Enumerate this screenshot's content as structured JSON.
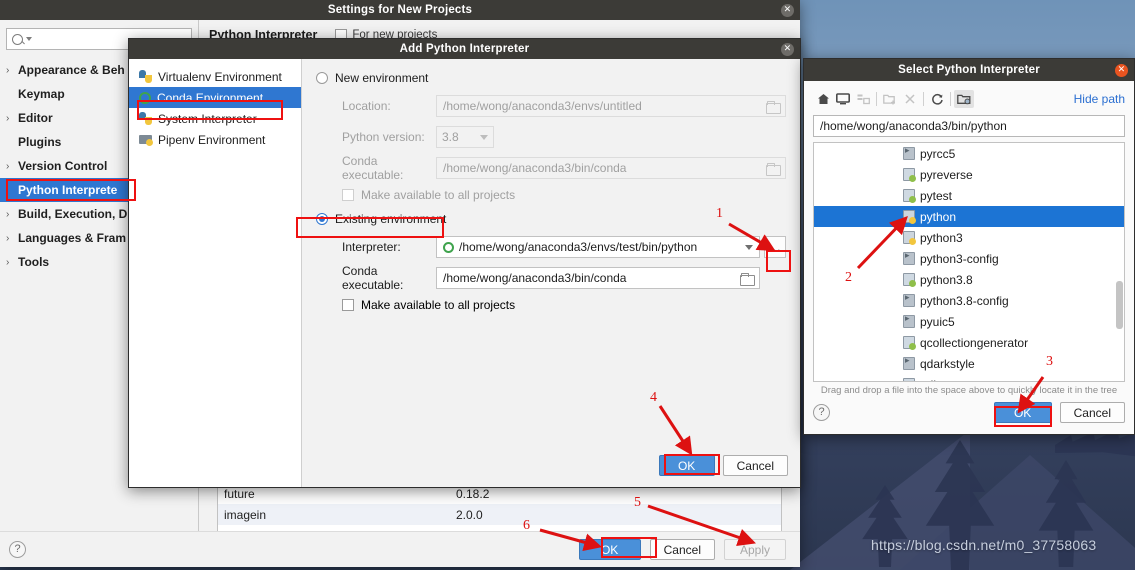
{
  "desktop": {
    "watermark": "https://blog.csdn.net/m0_37758063"
  },
  "settings_window": {
    "title": "Settings for New Projects",
    "close_label": "✕",
    "search_placeholder": "Q-",
    "nav_items": [
      {
        "label": "Appearance & Beh",
        "expandable": true,
        "selected": false
      },
      {
        "label": "Keymap",
        "expandable": false,
        "selected": false
      },
      {
        "label": "Editor",
        "expandable": true,
        "selected": false
      },
      {
        "label": "Plugins",
        "expandable": false,
        "selected": false
      },
      {
        "label": "Version Control",
        "expandable": true,
        "selected": false
      },
      {
        "label": "Python Interprete",
        "expandable": false,
        "selected": true
      },
      {
        "label": "Build, Execution, D",
        "expandable": true,
        "selected": false
      },
      {
        "label": "Languages & Fram",
        "expandable": true,
        "selected": false
      },
      {
        "label": "Tools",
        "expandable": true,
        "selected": false
      }
    ],
    "main_title": "Python Interpreter",
    "main_checkbox_label": "For new projects",
    "packages": {
      "rows": [
        {
          "name": "future",
          "version": "0.18.2"
        },
        {
          "name": "imagein",
          "version": "2.0.0"
        }
      ]
    },
    "footer": {
      "help_label": "?",
      "ok_label": "OK",
      "cancel_label": "Cancel",
      "apply_label": "Apply"
    }
  },
  "add_interpreter_dialog": {
    "title": "Add Python Interpreter",
    "close_label": "✕",
    "env_list": [
      {
        "label": "Virtualenv Environment",
        "icon": "virtualenv-icon",
        "selected": false
      },
      {
        "label": "Conda Environment",
        "icon": "conda-ring-icon",
        "selected": true
      },
      {
        "label": "System Interpreter",
        "icon": "python-icon",
        "selected": false
      },
      {
        "label": "Pipenv Environment",
        "icon": "pipenv-icon",
        "selected": false
      }
    ],
    "new_env": {
      "radio_label": "New environment",
      "selected": false,
      "location_label": "Location:",
      "location_value": "/home/wong/anaconda3/envs/untitled",
      "python_version_label": "Python version:",
      "python_version_value": "3.8",
      "conda_exec_label": "Conda executable:",
      "conda_exec_value": "/home/wong/anaconda3/bin/conda",
      "make_available_label": "Make available to all projects"
    },
    "existing_env": {
      "radio_label": "Existing environment",
      "selected": true,
      "interpreter_label": "Interpreter:",
      "interpreter_value": "/home/wong/anaconda3/envs/test/bin/python",
      "browse_label": "...",
      "conda_exec_label": "Conda executable:",
      "conda_exec_value": "/home/wong/anaconda3/bin/conda",
      "make_available_label": "Make available to all projects"
    },
    "footer": {
      "ok_label": "OK",
      "cancel_label": "Cancel"
    }
  },
  "select_interpreter_dialog": {
    "title": "Select Python Interpreter",
    "close_label": "✕",
    "toolbar": [
      {
        "name": "home-icon",
        "glyph": "⌂",
        "disabled": false,
        "toggled": false
      },
      {
        "name": "desktop-icon",
        "glyph": "▭",
        "disabled": false,
        "toggled": false
      },
      {
        "name": "collapse-all-icon",
        "glyph": "▤",
        "disabled": true,
        "toggled": false
      },
      {
        "name": "new-folder-icon",
        "glyph": "▣",
        "disabled": true,
        "toggled": false
      },
      {
        "name": "delete-icon",
        "glyph": "✕",
        "disabled": true,
        "toggled": false
      },
      {
        "name": "refresh-icon",
        "glyph": "↻",
        "disabled": false,
        "toggled": false
      },
      {
        "name": "show-hidden-icon",
        "glyph": "◑",
        "disabled": false,
        "toggled": true
      }
    ],
    "hide_path_label": "Hide path",
    "path_value": "/home/wong/anaconda3/bin/python",
    "files": [
      {
        "name": "pyrcc5",
        "icon": "exe",
        "selected": false
      },
      {
        "name": "pyreverse",
        "icon": "pyg",
        "selected": false
      },
      {
        "name": "pytest",
        "icon": "pyg",
        "selected": false
      },
      {
        "name": "python",
        "icon": "pyf",
        "selected": true
      },
      {
        "name": "python3",
        "icon": "pyf",
        "selected": false
      },
      {
        "name": "python3-config",
        "icon": "exe",
        "selected": false
      },
      {
        "name": "python3.8",
        "icon": "pyg",
        "selected": false
      },
      {
        "name": "python3.8-config",
        "icon": "exe",
        "selected": false
      },
      {
        "name": "pyuic5",
        "icon": "exe",
        "selected": false
      },
      {
        "name": "qcollectiongenerator",
        "icon": "pyg",
        "selected": false
      },
      {
        "name": "qdarkstyle",
        "icon": "exe",
        "selected": false
      },
      {
        "name": "qdbus",
        "icon": "pyg",
        "selected": false
      }
    ],
    "hint": "Drag and drop a file into the space above to quickly locate it in the tree",
    "footer": {
      "help_label": "?",
      "ok_label": "OK",
      "cancel_label": "Cancel"
    }
  },
  "annotations": {
    "numbers": [
      "1",
      "2",
      "3",
      "4",
      "5",
      "6"
    ],
    "color": "#dd1111"
  }
}
